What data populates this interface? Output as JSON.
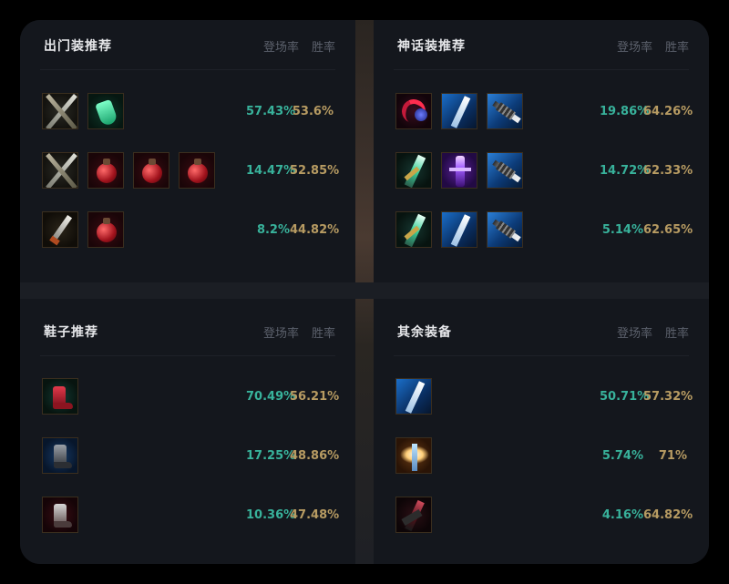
{
  "columns": {
    "pick_rate": "登场率",
    "win_rate": "胜率"
  },
  "panels": {
    "starter": {
      "title": "出门装推荐",
      "rows": [
        {
          "items": [
            "swords-icon",
            "green-potion-icon"
          ],
          "pick": "57.43%",
          "win": "53.6%"
        },
        {
          "items": [
            "swords-icon",
            "red-potion-icon",
            "red-potion-icon",
            "red-potion-icon"
          ],
          "pick": "14.47%",
          "win": "52.85%"
        },
        {
          "items": [
            "dagger-icon",
            "red-potion-icon"
          ],
          "pick": "8.2%",
          "win": "44.82%"
        }
      ]
    },
    "mythic": {
      "title": "神话装推荐",
      "rows": [
        {
          "items": [
            "scythe-icon",
            "blade-icon",
            "spear-icon"
          ],
          "pick": "19.86%",
          "win": "64.26%"
        },
        {
          "items": [
            "green-blade-icon",
            "purple-blade-icon",
            "spear-icon"
          ],
          "pick": "14.72%",
          "win": "62.33%"
        },
        {
          "items": [
            "green-blade-icon",
            "blade-icon",
            "spear-icon"
          ],
          "pick": "5.14%",
          "win": "62.65%"
        }
      ]
    },
    "boots": {
      "title": "鞋子推荐",
      "rows": [
        {
          "items": [
            "red-boots-icon"
          ],
          "pick": "70.49%",
          "win": "56.21%"
        },
        {
          "items": [
            "dark-boots-icon"
          ],
          "pick": "17.25%",
          "win": "48.86%"
        },
        {
          "items": [
            "plated-boots-icon"
          ],
          "pick": "10.36%",
          "win": "47.48%"
        }
      ]
    },
    "other": {
      "title": "其余装备",
      "rows": [
        {
          "items": [
            "blade-icon"
          ],
          "pick": "50.71%",
          "win": "57.32%"
        },
        {
          "items": [
            "angel-icon"
          ],
          "pick": "5.74%",
          "win": "71%"
        },
        {
          "items": [
            "dark-blade-icon"
          ],
          "pick": "4.16%",
          "win": "64.82%"
        }
      ]
    }
  },
  "colors": {
    "pick": "#38b29b",
    "win": "#b79b62",
    "title": "#e6e7ea",
    "column_header": "#5b606b"
  }
}
